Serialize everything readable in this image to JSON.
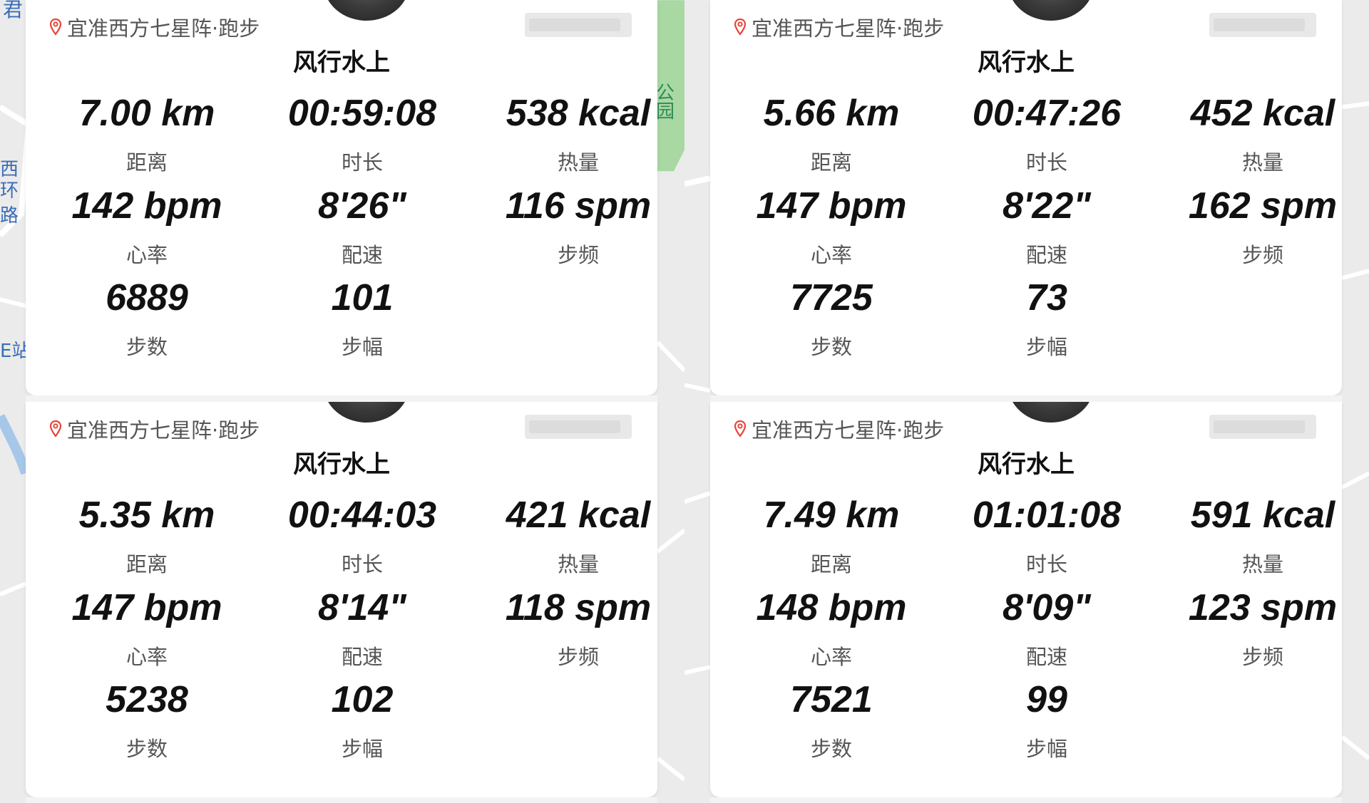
{
  "colors": {
    "map_background": "#ebebeb",
    "road": "#ffffff",
    "road_outline": "#d6d6d6",
    "park": "#a9d8a3",
    "map_label": "#3a6db8",
    "pin": "#e8443a",
    "value_text": "#111111",
    "label_text": "#555555"
  },
  "map_labels": {
    "top_left_edge": "君",
    "left_vertical_1": "西",
    "left_vertical_2": "环",
    "left_vertical_3": "路",
    "left_station": "E站",
    "park": "公园"
  },
  "cards": [
    {
      "location": "宜准西方七星阵·跑步",
      "title": "风行水上",
      "metrics": [
        {
          "value": "7.00 km",
          "label": "距离"
        },
        {
          "value": "00:59:08",
          "label": "时长"
        },
        {
          "value": "538 kcal",
          "label": "热量"
        },
        {
          "value": "142 bpm",
          "label": "心率"
        },
        {
          "value": "8'26\"",
          "label": "配速"
        },
        {
          "value": "116 spm",
          "label": "步频"
        },
        {
          "value": "6889",
          "label": "步数"
        },
        {
          "value": "101",
          "label": "步幅"
        }
      ]
    },
    {
      "location": "宜准西方七星阵·跑步",
      "title": "风行水上",
      "metrics": [
        {
          "value": "5.66 km",
          "label": "距离"
        },
        {
          "value": "00:47:26",
          "label": "时长"
        },
        {
          "value": "452 kcal",
          "label": "热量"
        },
        {
          "value": "147 bpm",
          "label": "心率"
        },
        {
          "value": "8'22\"",
          "label": "配速"
        },
        {
          "value": "162 spm",
          "label": "步频"
        },
        {
          "value": "7725",
          "label": "步数"
        },
        {
          "value": "73",
          "label": "步幅"
        }
      ]
    },
    {
      "location": "宜准西方七星阵·跑步",
      "title": "风行水上",
      "metrics": [
        {
          "value": "5.35 km",
          "label": "距离"
        },
        {
          "value": "00:44:03",
          "label": "时长"
        },
        {
          "value": "421 kcal",
          "label": "热量"
        },
        {
          "value": "147 bpm",
          "label": "心率"
        },
        {
          "value": "8'14\"",
          "label": "配速"
        },
        {
          "value": "118 spm",
          "label": "步频"
        },
        {
          "value": "5238",
          "label": "步数"
        },
        {
          "value": "102",
          "label": "步幅"
        }
      ]
    },
    {
      "location": "宜准西方七星阵·跑步",
      "title": "风行水上",
      "metrics": [
        {
          "value": "7.49 km",
          "label": "距离"
        },
        {
          "value": "01:01:08",
          "label": "时长"
        },
        {
          "value": "591 kcal",
          "label": "热量"
        },
        {
          "value": "148 bpm",
          "label": "心率"
        },
        {
          "value": "8'09\"",
          "label": "配速"
        },
        {
          "value": "123 spm",
          "label": "步频"
        },
        {
          "value": "7521",
          "label": "步数"
        },
        {
          "value": "99",
          "label": "步幅"
        }
      ]
    }
  ]
}
